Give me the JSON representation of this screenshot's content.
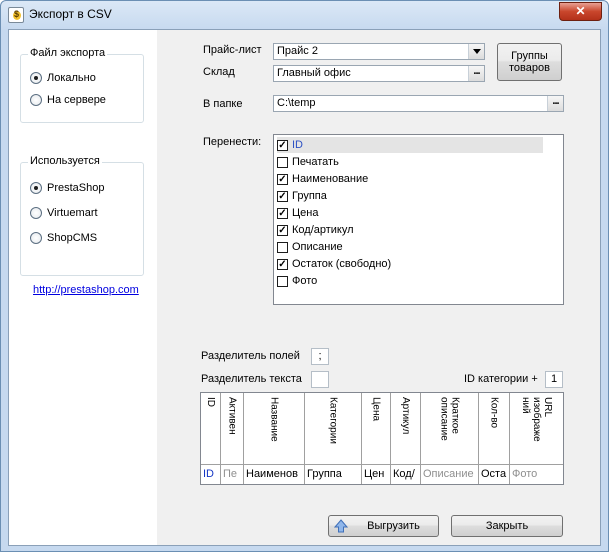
{
  "window": {
    "title": "Экспорт в CSV",
    "close_glyph": "✕"
  },
  "left": {
    "export_file": {
      "title": "Файл экспорта",
      "options": [
        {
          "label": "Локально",
          "checked": true
        },
        {
          "label": "На сервере",
          "checked": false
        }
      ]
    },
    "used": {
      "title": "Используется",
      "options": [
        {
          "label": "PrestaShop",
          "checked": true
        },
        {
          "label": "Virtuemart",
          "checked": false
        },
        {
          "label": "ShopCMS",
          "checked": false
        }
      ]
    },
    "link": "http://prestashop.com"
  },
  "form": {
    "pricelist_label": "Прайс-лист",
    "pricelist_value": "Прайс 2",
    "warehouse_label": "Склад",
    "warehouse_value": "Главный офис",
    "groups_button": "Группы товаров",
    "folder_label": "В папке",
    "folder_value": "C:\\temp",
    "transfer_label": "Перенести:",
    "dots": "...",
    "fields": [
      {
        "label": "ID",
        "checked": true,
        "selected": true
      },
      {
        "label": "Печатать",
        "checked": false,
        "selected": false
      },
      {
        "label": "Наименование",
        "checked": true,
        "selected": false
      },
      {
        "label": "Группа",
        "checked": true,
        "selected": false
      },
      {
        "label": "Цена",
        "checked": true,
        "selected": false
      },
      {
        "label": "Код/артикул",
        "checked": true,
        "selected": false
      },
      {
        "label": "Описание",
        "checked": false,
        "selected": false
      },
      {
        "label": "Остаток (свободно)",
        "checked": true,
        "selected": false
      },
      {
        "label": "Фото",
        "checked": false,
        "selected": false
      }
    ],
    "field_sep_label": "Разделитель полей",
    "field_sep_value": ";",
    "text_sep_label": "Разделитель текста",
    "text_sep_value": "",
    "category_id_label": "ID категории +",
    "category_id_value": "1"
  },
  "preview_grid": {
    "columns": [
      {
        "header": "ID",
        "cell": "ID",
        "style": "blue"
      },
      {
        "header": "Активен",
        "cell": "Пе",
        "style": "gray"
      },
      {
        "header": "Название",
        "cell": "Наименов",
        "style": ""
      },
      {
        "header": "Категории",
        "cell": "Группа",
        "style": ""
      },
      {
        "header": "Цена",
        "cell": "Цен",
        "style": ""
      },
      {
        "header": "Артикул",
        "cell": "Код/",
        "style": ""
      },
      {
        "header": "Краткое\nописание",
        "cell": "Описание",
        "style": "gray"
      },
      {
        "header": "Кол-во",
        "cell": "Оста",
        "style": ""
      },
      {
        "header": "URL\nизображе\nний",
        "cell": "Фото",
        "style": "gray"
      }
    ]
  },
  "footer": {
    "export_button": "Выгрузить",
    "close_button": "Закрыть"
  }
}
